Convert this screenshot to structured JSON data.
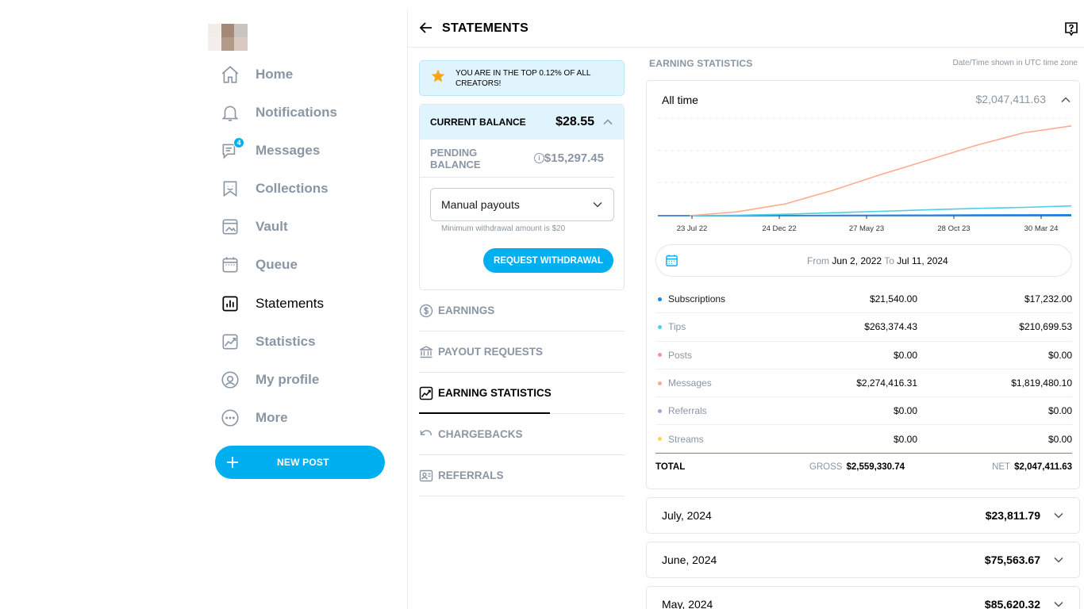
{
  "sidebar": {
    "items": [
      {
        "label": "Home",
        "icon": "home-icon"
      },
      {
        "label": "Notifications",
        "icon": "bell-icon"
      },
      {
        "label": "Messages",
        "icon": "message-icon",
        "badge": "4"
      },
      {
        "label": "Collections",
        "icon": "bookmark-icon"
      },
      {
        "label": "Vault",
        "icon": "image-icon"
      },
      {
        "label": "Queue",
        "icon": "calendar-icon"
      },
      {
        "label": "Statements",
        "icon": "bar-chart-icon",
        "active": true
      },
      {
        "label": "Statistics",
        "icon": "trend-icon"
      },
      {
        "label": "My profile",
        "icon": "user-icon"
      },
      {
        "label": "More",
        "icon": "more-icon"
      }
    ],
    "new_post_label": "NEW POST"
  },
  "header": {
    "title": "STATEMENTS"
  },
  "balance": {
    "top_banner": "YOU ARE IN THE TOP 0.12% OF ALL CREATORS!",
    "current_label": "CURRENT BALANCE",
    "current_value": "$28.55",
    "pending_label": "PENDING BALANCE",
    "pending_value": "$15,297.45",
    "payout_mode": "Manual payouts",
    "min_withdrawal_hint": "Minimum withdrawal amount is $20",
    "request_button": "REQUEST WITHDRAWAL"
  },
  "sub_nav": [
    {
      "label": "EARNINGS",
      "icon": "dollar-circle-icon"
    },
    {
      "label": "PAYOUT REQUESTS",
      "icon": "bank-icon"
    },
    {
      "label": "EARNING STATISTICS",
      "icon": "trend-icon",
      "active": true
    },
    {
      "label": "CHARGEBACKS",
      "icon": "undo-icon"
    },
    {
      "label": "REFERRALS",
      "icon": "referral-icon"
    }
  ],
  "stats": {
    "section_label": "EARNING STATISTICS",
    "timezone_note": "Date/Time shown in UTC time zone",
    "period_label": "All time",
    "period_total": "$2,047,411.63",
    "date_from_label": "From",
    "date_from": "Jun 2, 2022",
    "date_to_label": "To",
    "date_to": "Jul 11, 2024",
    "rows": [
      {
        "name": "Subscriptions",
        "gross": "$21,540.00",
        "net": "$17,232.00",
        "color": "#1e88e5"
      },
      {
        "name": "Tips",
        "gross": "$263,374.43",
        "net": "$210,699.53",
        "color": "#4dd0e1"
      },
      {
        "name": "Posts",
        "gross": "$0.00",
        "net": "$0.00",
        "color": "#f48fb1"
      },
      {
        "name": "Messages",
        "gross": "$2,274,416.31",
        "net": "$1,819,480.10",
        "color": "#ffab91"
      },
      {
        "name": "Referrals",
        "gross": "$0.00",
        "net": "$0.00",
        "color": "#b39ddb"
      },
      {
        "name": "Streams",
        "gross": "$0.00",
        "net": "$0.00",
        "color": "#ffd54f"
      }
    ],
    "total_label": "TOTAL",
    "gross_label": "GROSS",
    "total_gross": "$2,559,330.74",
    "net_label": "NET",
    "total_net": "$2,047,411.63"
  },
  "months": [
    {
      "label": "July, 2024",
      "value": "$23,811.79"
    },
    {
      "label": "June, 2024",
      "value": "$75,563.67"
    },
    {
      "label": "May, 2024",
      "value": "$85,620.32"
    }
  ],
  "chart_data": {
    "type": "line",
    "x_tick_labels": [
      "23 Jul 22",
      "24 Dec 22",
      "27 May 23",
      "28 Oct 23",
      "30 Mar 24"
    ],
    "series": [
      {
        "name": "Messages",
        "color": "#ffab91",
        "values": [
          0.0,
          0.04,
          0.12,
          0.26,
          0.42,
          0.57,
          0.72,
          0.85,
          0.92
        ]
      },
      {
        "name": "Tips",
        "color": "#4dd0e1",
        "values": [
          0.0,
          0.005,
          0.015,
          0.03,
          0.045,
          0.06,
          0.075,
          0.085,
          0.1
        ]
      },
      {
        "name": "Subscriptions",
        "color": "#1e88e5",
        "values": [
          0.0,
          0.0,
          0.002,
          0.004,
          0.005,
          0.006,
          0.008,
          0.009,
          0.01
        ]
      }
    ],
    "grid": true
  }
}
